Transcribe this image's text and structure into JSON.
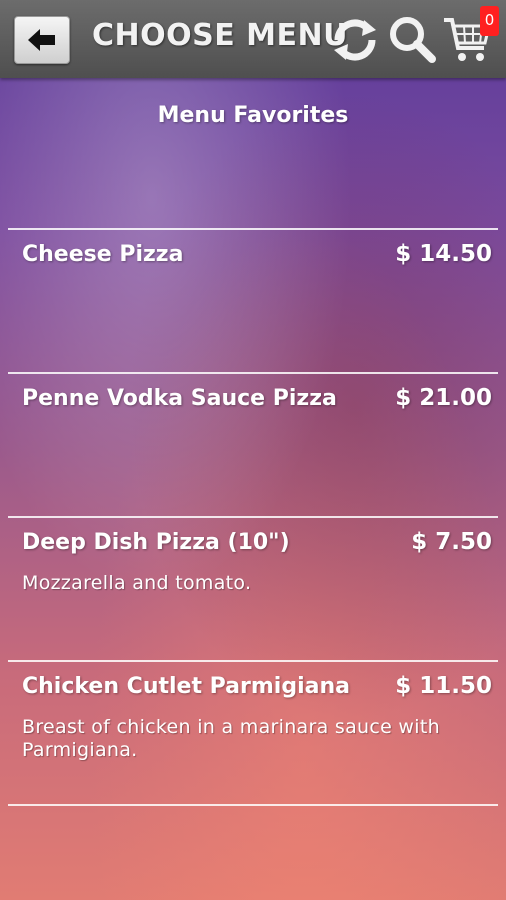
{
  "header": {
    "title": "CHOOSE MENU",
    "cart_count": "0",
    "icons": [
      "back-arrow-icon",
      "refresh-icon",
      "search-icon",
      "cart-icon"
    ]
  },
  "section": {
    "title": "Menu Favorites"
  },
  "items": [
    {
      "name": "Cheese Pizza",
      "price": "$ 14.50",
      "description": ""
    },
    {
      "name": "Penne Vodka Sauce Pizza",
      "price": "$ 21.00",
      "description": ""
    },
    {
      "name": "Deep Dish Pizza (10\")",
      "price": "$ 7.50",
      "description": "Mozzarella and tomato."
    },
    {
      "name": "Chicken Cutlet Parmigiana",
      "price": "$ 11.50",
      "description": "Breast of chicken in a marinara sauce with Parmigiana."
    }
  ],
  "colors": {
    "header_bg": "#555555",
    "badge": "#ff2020",
    "background_top": "#5b3b9b",
    "background_bottom": "#e17c73"
  }
}
